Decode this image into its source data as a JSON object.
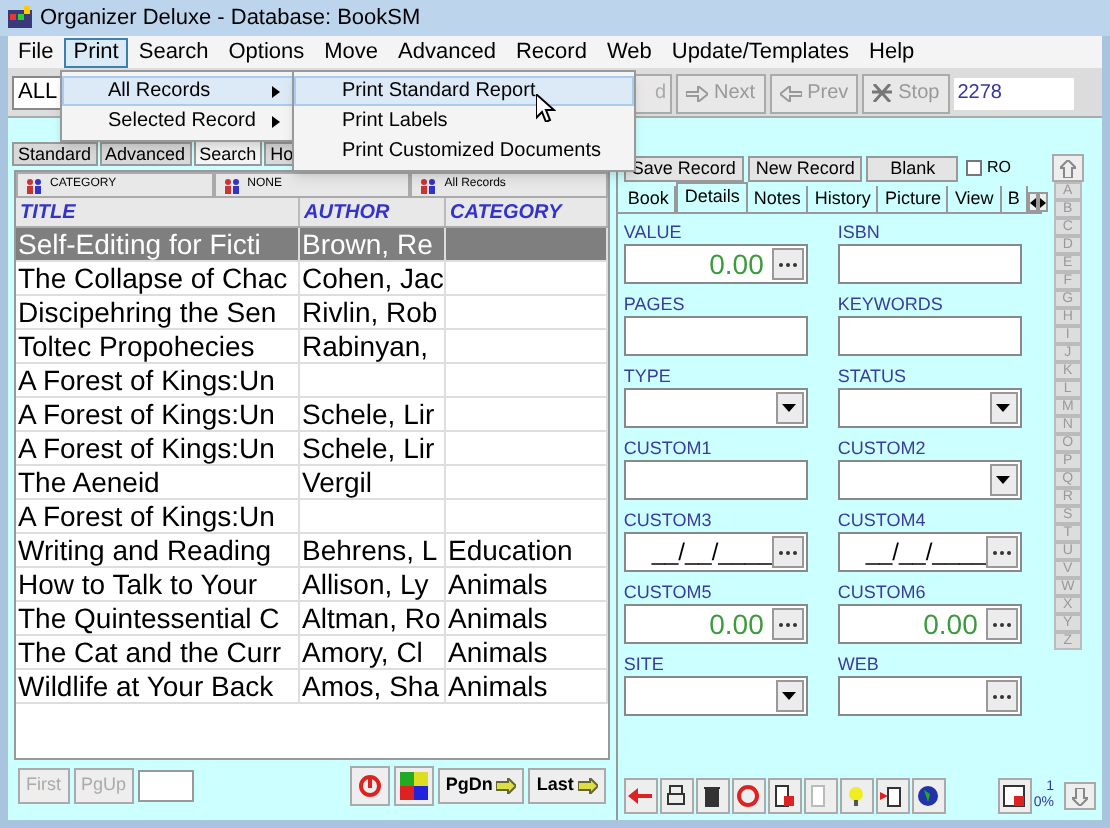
{
  "window": {
    "title": "Organizer Deluxe - Database: BookSM"
  },
  "menu": [
    {
      "label": "File",
      "selected": false
    },
    {
      "label": "Print",
      "selected": true
    },
    {
      "label": "Search",
      "selected": false
    },
    {
      "label": "Options",
      "selected": false
    },
    {
      "label": "Move",
      "selected": false
    },
    {
      "label": "Advanced",
      "selected": false
    },
    {
      "label": "Record",
      "selected": false
    },
    {
      "label": "Web",
      "selected": false
    },
    {
      "label": "Update/Templates",
      "selected": false
    },
    {
      "label": "Help",
      "selected": false
    }
  ],
  "print_menu": [
    {
      "label": "All Records",
      "selected": true
    },
    {
      "label": "Selected Record",
      "selected": false
    }
  ],
  "print_submenu": [
    {
      "label": "Print Standard Report",
      "selected": true
    },
    {
      "label": "Print Labels",
      "selected": false
    },
    {
      "label": "Print Customized Documents",
      "selected": false
    }
  ],
  "toolbar": {
    "scope": "ALL",
    "cut_button": "d",
    "buttons": [
      {
        "label": "Next",
        "kind": "next"
      },
      {
        "label": "Prev",
        "kind": "prev"
      },
      {
        "label": "Stop",
        "kind": "stop"
      }
    ],
    "record_number": "2278"
  },
  "view_tabs": [
    {
      "label": "Standard",
      "selected": false
    },
    {
      "label": "Advanced",
      "selected": false
    },
    {
      "label": "Search",
      "selected": true
    },
    {
      "label": "Ho",
      "selected": false
    }
  ],
  "filters": [
    "CATEGORY",
    "NONE",
    "All Records"
  ],
  "table": {
    "columns": [
      "TITLE",
      "AUTHOR",
      "CATEGORY"
    ],
    "rows": [
      {
        "cells": [
          "Self-Editing for Ficti",
          "Brown, Re",
          ""
        ],
        "selected": true
      },
      {
        "cells": [
          "The Collapse of Chac",
          "Cohen, Jac",
          ""
        ],
        "selected": false
      },
      {
        "cells": [
          "Discipehring the Sen",
          "Rivlin, Rob",
          ""
        ],
        "selected": false
      },
      {
        "cells": [
          "Toltec Propohecies",
          "Rabinyan,",
          ""
        ],
        "selected": false
      },
      {
        "cells": [
          "A Forest of Kings:Un",
          "",
          ""
        ],
        "selected": false
      },
      {
        "cells": [
          "A Forest of Kings:Un",
          "Schele, Lir",
          ""
        ],
        "selected": false
      },
      {
        "cells": [
          "A Forest of Kings:Un",
          "Schele, Lir",
          ""
        ],
        "selected": false
      },
      {
        "cells": [
          "The Aeneid",
          "Vergil",
          ""
        ],
        "selected": false
      },
      {
        "cells": [
          "A Forest of Kings:Un",
          "",
          ""
        ],
        "selected": false
      },
      {
        "cells": [
          "Writing and Reading",
          "Behrens, L",
          "Education"
        ],
        "selected": false
      },
      {
        "cells": [
          "How to Talk to Your",
          "Allison, Ly",
          "Animals"
        ],
        "selected": false
      },
      {
        "cells": [
          "The Quintessential C",
          "Altman, Ro",
          "Animals"
        ],
        "selected": false
      },
      {
        "cells": [
          "The Cat and the Curr",
          "Amory, Cl",
          "Animals"
        ],
        "selected": false
      },
      {
        "cells": [
          "Wildlife at Your Back",
          "Amos, Sha",
          "Animals"
        ],
        "selected": false
      }
    ]
  },
  "nav": [
    {
      "label": "First",
      "disabled": true
    },
    {
      "label": "PgUp",
      "disabled": true
    },
    {
      "label": "PgDn",
      "disabled": false
    },
    {
      "label": "Last",
      "disabled": false
    }
  ],
  "record_actions": [
    "Save Record",
    "New Record",
    "Blank"
  ],
  "read_only": {
    "label": "RO",
    "checked": false
  },
  "detail_tabs": [
    {
      "label": "Book",
      "selected": false
    },
    {
      "label": "Details",
      "selected": true
    },
    {
      "label": "Notes",
      "selected": false
    },
    {
      "label": "History",
      "selected": false
    },
    {
      "label": "Picture",
      "selected": false
    },
    {
      "label": "View",
      "selected": false
    },
    {
      "label": "B",
      "selected": false
    }
  ],
  "fields": [
    {
      "label": "VALUE",
      "kind": "number",
      "value": "0.00"
    },
    {
      "label": "ISBN",
      "kind": "text"
    },
    {
      "label": "PAGES",
      "kind": "text"
    },
    {
      "label": "KEYWORDS",
      "kind": "text"
    },
    {
      "label": "TYPE",
      "kind": "dropdown"
    },
    {
      "label": "STATUS",
      "kind": "dropdown"
    },
    {
      "label": "CUSTOM1",
      "kind": "text"
    },
    {
      "label": "CUSTOM2",
      "kind": "dropdown"
    },
    {
      "label": "CUSTOM3",
      "kind": "date",
      "value": "__/__/____"
    },
    {
      "label": "CUSTOM4",
      "kind": "date",
      "value": "__/__/____"
    },
    {
      "label": "CUSTOM5",
      "kind": "number",
      "value": "0.00"
    },
    {
      "label": "CUSTOM6",
      "kind": "number",
      "value": "0.00"
    },
    {
      "label": "SITE",
      "kind": "dropdown"
    },
    {
      "label": "WEB",
      "kind": "link"
    }
  ],
  "alphabet": [
    "A",
    "B",
    "C",
    "D",
    "E",
    "F",
    "G",
    "H",
    "I",
    "J",
    "K",
    "L",
    "M",
    "N",
    "O",
    "P",
    "Q",
    "R",
    "S",
    "T",
    "U",
    "V",
    "W",
    "X",
    "Y",
    "Z"
  ],
  "status": {
    "count": "1",
    "percent": "0%"
  }
}
